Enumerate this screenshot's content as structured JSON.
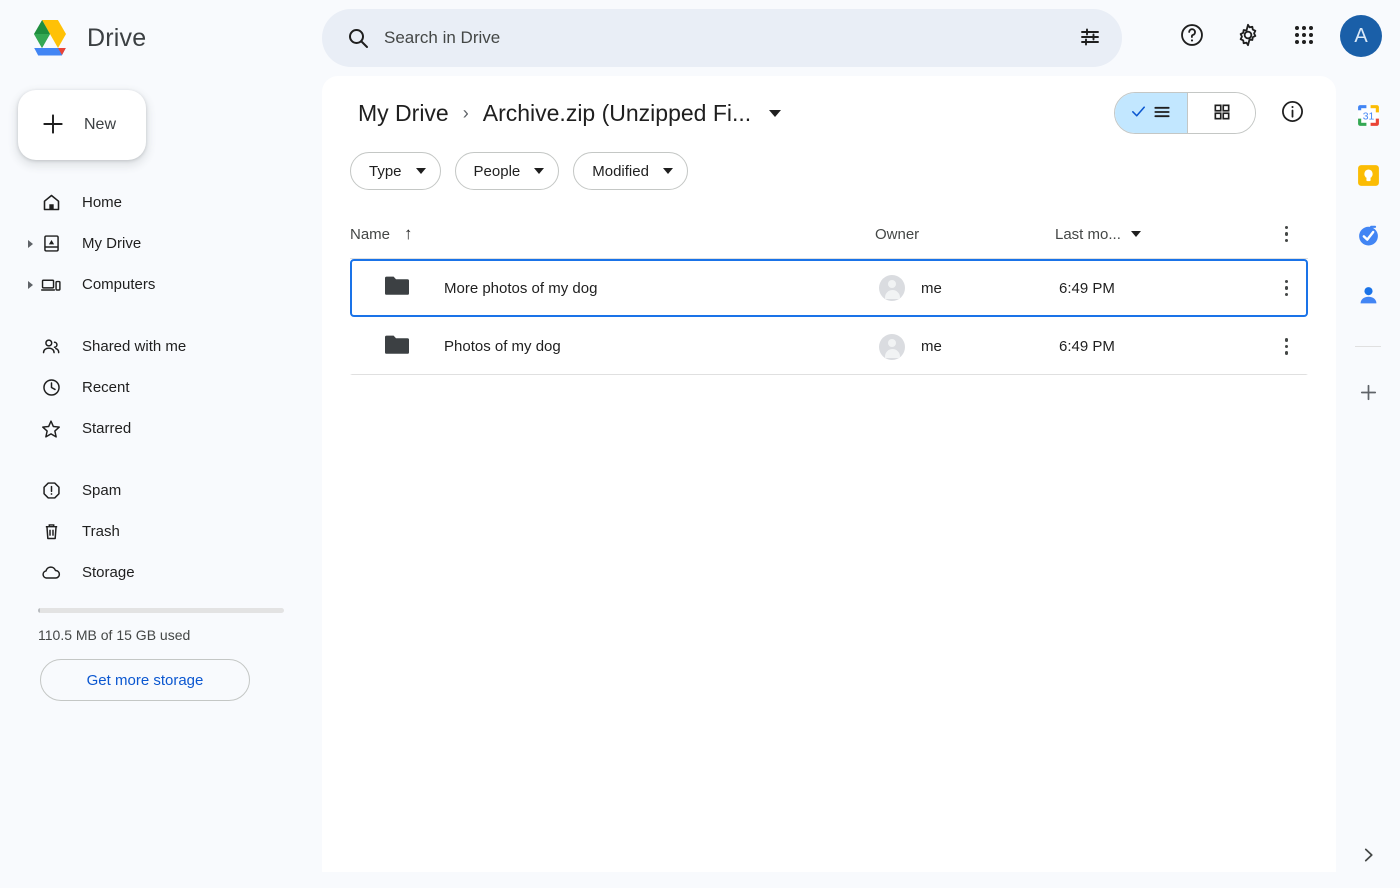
{
  "app": {
    "name": "Drive",
    "logo_icon": "drive-logo-icon"
  },
  "search": {
    "placeholder": "Search in Drive",
    "value": "",
    "search_icon": "search-icon",
    "tune_icon": "tune-filter-icon"
  },
  "topbar": {
    "help_icon": "help-circle-icon",
    "settings_icon": "gear-icon",
    "apps_icon": "apps-grid-icon",
    "avatar_initial": "A",
    "avatar_color": "#1a5fa8"
  },
  "sidebar": {
    "new_button": {
      "label": "New",
      "icon": "plus-icon"
    },
    "items": [
      {
        "label": "Home",
        "icon": "home-icon",
        "expandable": false
      },
      {
        "label": "My Drive",
        "icon": "my-drive-icon",
        "expandable": true
      },
      {
        "label": "Computers",
        "icon": "computers-icon",
        "expandable": true
      },
      {
        "label": "Shared with me",
        "icon": "people-icon",
        "expandable": false
      },
      {
        "label": "Recent",
        "icon": "clock-icon",
        "expandable": false
      },
      {
        "label": "Starred",
        "icon": "star-icon",
        "expandable": false
      },
      {
        "label": "Spam",
        "icon": "spam-icon",
        "expandable": false
      },
      {
        "label": "Trash",
        "icon": "trash-icon",
        "expandable": false
      },
      {
        "label": "Storage",
        "icon": "cloud-icon",
        "expandable": false
      }
    ],
    "storage": {
      "used_text": "110.5 MB of 15 GB used",
      "percent": 0.72,
      "get_more_label": "Get more storage",
      "link_color": "#0b57d0"
    }
  },
  "main": {
    "breadcrumb": {
      "root": "My Drive",
      "separator": "›",
      "current": "Archive.zip (Unzipped Fi...",
      "caret_icon": "chevron-down-icon"
    },
    "view_toggle": {
      "list_label": "list-view",
      "grid_label": "grid-view",
      "active": "list"
    },
    "info_icon": "info-circle-icon",
    "filters": [
      {
        "label": "Type",
        "icon": "chevron-down-icon"
      },
      {
        "label": "People",
        "icon": "chevron-down-icon"
      },
      {
        "label": "Modified",
        "icon": "chevron-down-icon"
      }
    ],
    "table": {
      "headers": {
        "name": "Name",
        "sort_arrow": "↑",
        "owner": "Owner",
        "modified": "Last mo...",
        "menu_icon": "more-vertical-icon"
      },
      "rows": [
        {
          "name": "More photos of my dog",
          "icon": "folder-icon",
          "owner": "me",
          "modified": "6:49 PM",
          "selected": true
        },
        {
          "name": "Photos of my dog",
          "icon": "folder-icon",
          "owner": "me",
          "modified": "6:49 PM",
          "selected": false
        }
      ]
    }
  },
  "right_rail": {
    "items": [
      {
        "name": "google-calendar-icon",
        "badge": "31"
      },
      {
        "name": "google-keep-icon"
      },
      {
        "name": "google-tasks-icon"
      },
      {
        "name": "google-contacts-icon"
      }
    ],
    "add_icon": "plus-icon",
    "expand_icon": "chevron-right-icon"
  },
  "colors": {
    "accent_blue": "#1a73e8",
    "chip_selected": "#c2e7ff",
    "page_bg": "#f8fafd",
    "panel_bg": "#ffffff"
  }
}
